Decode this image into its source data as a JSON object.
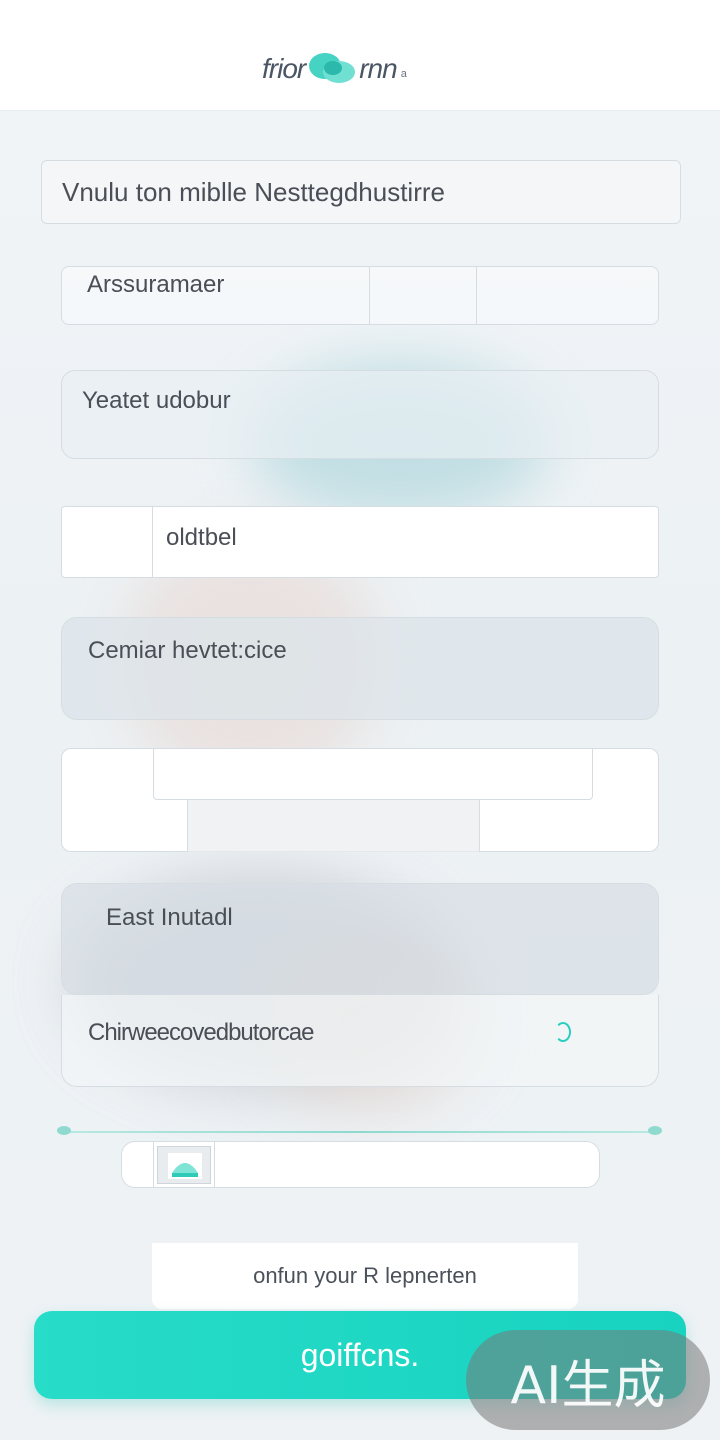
{
  "header": {
    "logo_text": "frior",
    "logo_suffix": "rnn",
    "logo_small": "a",
    "logo_color": "#3ccfbf"
  },
  "form": {
    "top_field": "Vnulu ton miblle Nesttegdhustirre",
    "field_assurance": "Arssuramaer",
    "field_yeatet": "Yeatet udobur",
    "field_oddtbel": "oldtbel",
    "field_cemiar": "Cemiar hevtet:cice",
    "field_east": "East Inutadl",
    "field_chirwee": "Chirweecovedbutorcae",
    "spinner_icon": "loading-spinner-icon",
    "toggle_icon": "image-toggle-icon"
  },
  "confirm_text": "onfun your R lepnerten",
  "primary_button": "goiffcns.",
  "watermark": "AI生成",
  "accent_color": "#1fd6c3"
}
